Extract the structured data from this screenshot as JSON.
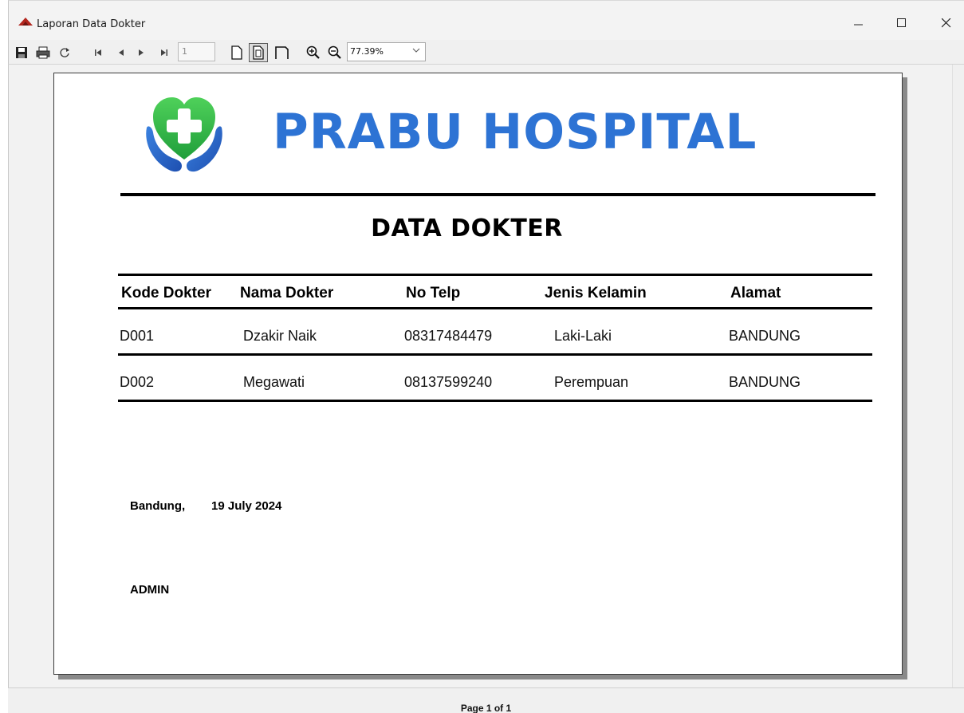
{
  "window": {
    "title": "Laporan Data Dokter",
    "controls": [
      "minimize-icon",
      "maximize-icon",
      "close-icon"
    ]
  },
  "toolbar": {
    "page_number": "1",
    "zoom": "77.39%",
    "icons": [
      "save-icon",
      "print-icon",
      "refresh-icon",
      "first-page-icon",
      "prev-page-icon",
      "next-page-icon",
      "last-page-icon",
      "actual-size-icon",
      "whole-page-icon",
      "page-width-icon",
      "zoom-in-icon",
      "zoom-out-icon"
    ]
  },
  "report": {
    "hospital_name": "PRABU HOSPITAL",
    "title": "DATA DOKTER",
    "columns": [
      "Kode Dokter",
      "Nama Dokter",
      "No Telp",
      "Jenis Kelamin",
      "Alamat"
    ],
    "rows": [
      [
        "D001",
        "Dzakir Naik",
        "08317484479",
        "Laki-Laki",
        "BANDUNG"
      ],
      [
        "D002",
        "Megawati",
        "08137599240",
        "Perempuan",
        "BANDUNG"
      ]
    ],
    "signature_city": "Bandung,",
    "signature_date": "19 July 2024",
    "signature_name": "ADMIN"
  },
  "colors": {
    "brand_blue": "#2d73d4",
    "logo_green": "#3cc24a"
  },
  "status": {
    "page_info": "Page 1 of 1"
  }
}
